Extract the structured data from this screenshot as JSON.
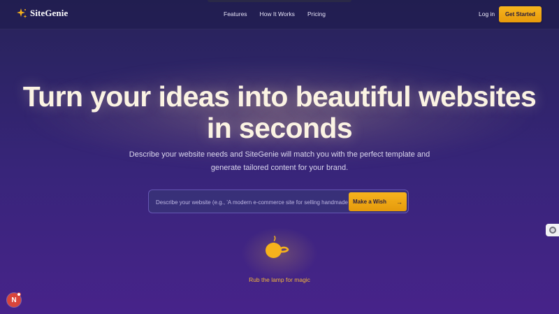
{
  "brand": {
    "name": "SiteGenie",
    "icon": "sparkle-icon"
  },
  "nav": {
    "links": [
      "Features",
      "How It Works",
      "Pricing"
    ],
    "login_label": "Log in",
    "cta_label": "Get Started"
  },
  "hero": {
    "title": "Turn your ideas into beautiful websites in seconds",
    "subtitle": "Describe your website needs and SiteGenie will match you with the perfect template and generate tailored content for your brand."
  },
  "search": {
    "placeholder": "Describe your website (e.g., 'A modern e-commerce site for selling handmade jewelry')",
    "button_label": "Make a Wish",
    "button_icon": "arrow-right-icon"
  },
  "lamp": {
    "icon": "magic-lamp-icon",
    "caption": "Rub the lamp for magic"
  },
  "badge": {
    "letter": "N"
  },
  "colors": {
    "accent": "#f5b01c",
    "background": "#2d2466",
    "caption": "#f3b63a"
  }
}
